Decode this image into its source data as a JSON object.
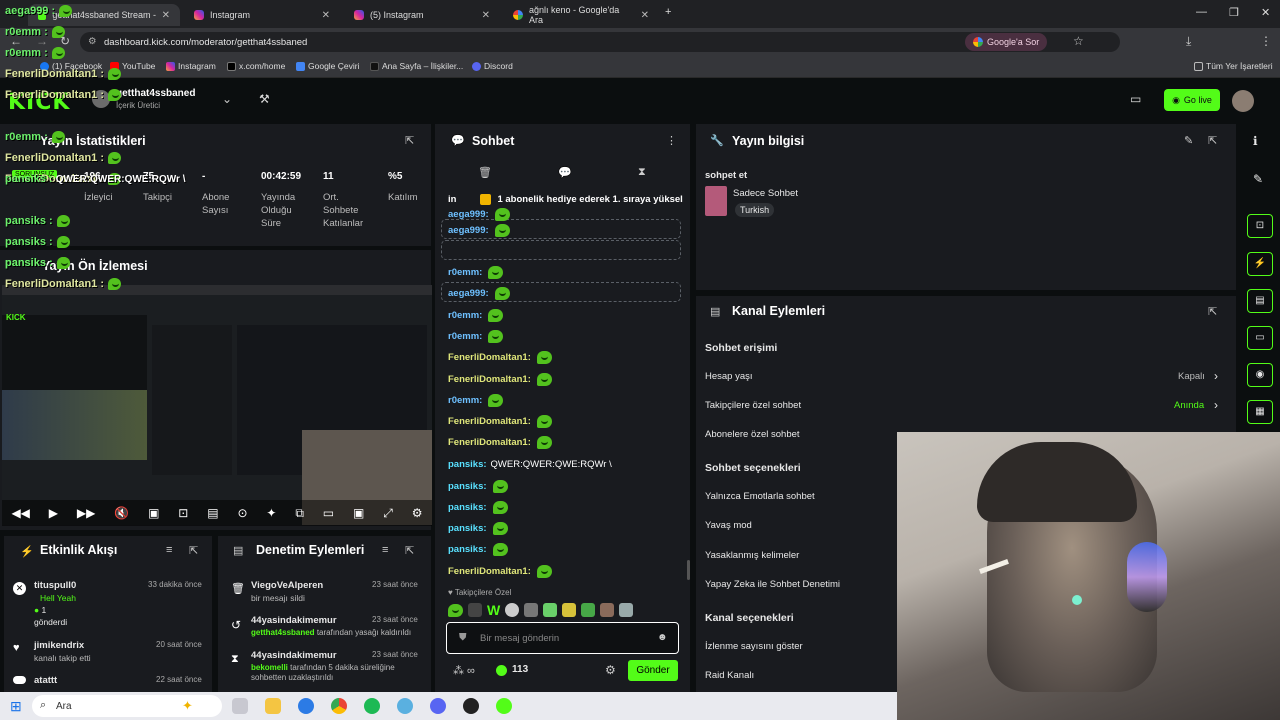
{
  "browser": {
    "tabs": [
      {
        "label": "getthat4ssbaned Stream - Kick",
        "active": true
      },
      {
        "label": "Instagram"
      },
      {
        "label": "(5) Instagram"
      },
      {
        "label": "ağnlı keno - Google'da Ara"
      }
    ],
    "url": "dashboard.kick.com/moderator/getthat4ssbaned",
    "gsor": "Google'a Sor",
    "bookmarks": [
      "(1) Facebook",
      "YouTube",
      "Instagram",
      "x.com/home",
      "Google Çeviri",
      "Ana Sayfa – İlişkiler...",
      "Discord"
    ],
    "all_bookmarks": "Tüm Yer İşaretleri"
  },
  "dash": {
    "logo": "KICK",
    "channel": "getthat4ssbaned",
    "role": "İçerik Üretici",
    "golive": "Go live"
  },
  "stats": {
    "title": "Yayın İstatistikleri",
    "items": [
      {
        "value": "196",
        "label": "İzleyici"
      },
      {
        "value": "75",
        "label": "Takipçi"
      },
      {
        "value": "-",
        "label": "Abone Sayısı"
      },
      {
        "value": "00:42:59",
        "label": "Yayında Olduğu Süre"
      },
      {
        "value": "11",
        "label": "Ort. Sohbete Katılanlar"
      },
      {
        "value": "%5",
        "label": "Katılım"
      }
    ],
    "badge": "SORUNSUZ"
  },
  "preview": {
    "title": "Yayın Ön İzlemesi"
  },
  "overlay_chat": [
    {
      "user": "aega999 :",
      "green": true
    },
    {
      "user": "r0emm :",
      "green": true
    },
    {
      "user": "r0emm :",
      "green": true
    },
    {
      "user": "FenerliDomaltan1 :",
      "green": false
    },
    {
      "user": "FenerliDomaltan1 :",
      "green": false
    },
    {
      "user": "r0emm :",
      "green": true
    },
    {
      "user": "FenerliDomaltan1 :",
      "green": false
    },
    {
      "user": "FenerliDomaltan1 :",
      "green": false
    },
    {
      "user": "pansiks :",
      "green": true,
      "text": "QWER:QWER:QWE:RQWr \\"
    },
    {
      "user": "pansiks :",
      "green": true
    },
    {
      "user": "pansiks :",
      "green": true
    },
    {
      "user": "pansiks :",
      "green": true
    },
    {
      "user": "pansiks :",
      "green": true
    },
    {
      "user": "FenerliDomaltan1 :",
      "green": false
    }
  ],
  "activity": {
    "title": "Etkinlik Akışı",
    "items": [
      {
        "user": "tituspull0",
        "time": "33 dakika önce",
        "sub": "Hell Yeah",
        "extra": "1",
        "desc": "gönderdi"
      },
      {
        "user": "jimikendrix",
        "time": "20 saat önce",
        "desc": "kanalı takip etti"
      },
      {
        "user": "atattt",
        "time": "22 saat önce"
      }
    ]
  },
  "moderation": {
    "title": "Denetim Eylemleri",
    "items": [
      {
        "user": "ViegoVeAlperen",
        "time": "23 saat önce",
        "desc": "bir mesajı sildi"
      },
      {
        "user": "44yasindakimemur",
        "time": "23 saat önce",
        "target": "getthat4ssbaned",
        "desc": "tarafından yasağı kaldırıldı"
      },
      {
        "user": "44yasindakimemur",
        "time": "23 saat önce",
        "target": "bekomelli",
        "desc": "tarafından 5 dakika süreliğine sohbetten uzaklaştırıldı"
      }
    ]
  },
  "chat": {
    "title": "Sohbet",
    "pinned_prefix": "in",
    "pinned": "1 abonelik hediye ederek 1. sıraya yüksel",
    "messages": [
      {
        "user": "aega999:",
        "color": "#6ec0ff",
        "boxed": true
      },
      {
        "user": "aega999:",
        "color": "#6ec0ff",
        "boxed": true
      },
      {
        "user": "r0emm:",
        "color": "#6ec0ff"
      },
      {
        "user": "aega999:",
        "color": "#6ec0ff",
        "boxed": true
      },
      {
        "user": "r0emm:",
        "color": "#6ec0ff"
      },
      {
        "user": "r0emm:",
        "color": "#6ec0ff"
      },
      {
        "user": "FenerliDomaltan1:",
        "color": "#dfe67a"
      },
      {
        "user": "FenerliDomaltan1:",
        "color": "#dfe67a"
      },
      {
        "user": "r0emm:",
        "color": "#6ec0ff"
      },
      {
        "user": "FenerliDomaltan1:",
        "color": "#dfe67a"
      },
      {
        "user": "FenerliDomaltan1:",
        "color": "#dfe67a"
      },
      {
        "user": "pansiks:",
        "color": "#59e1ff",
        "text": "QWER:QWER:QWE:RQWr \\"
      },
      {
        "user": "pansiks:",
        "color": "#59e1ff"
      },
      {
        "user": "pansiks:",
        "color": "#59e1ff"
      },
      {
        "user": "pansiks:",
        "color": "#59e1ff"
      },
      {
        "user": "pansiks:",
        "color": "#59e1ff"
      },
      {
        "user": "FenerliDomaltan1:",
        "color": "#dfe67a"
      }
    ],
    "followers_only": "Takipçilere Özel",
    "placeholder": "Bir mesaj gönderin",
    "points": "113",
    "send": "Gönder"
  },
  "stream_info": {
    "title": "Yayın bilgisi",
    "stream_title": "sohpet et",
    "category": "Sadece Sohbet",
    "tag": "Turkish"
  },
  "channel_actions": {
    "title": "Kanal Eylemleri",
    "chat_access": "Sohbet erişimi",
    "account_age": "Hesap yaşı",
    "account_age_val": "Kapalı",
    "followers_chat": "Takipçilere özel sohbet",
    "followers_chat_val": "Anında",
    "subs_chat": "Abonelere özel sohbet",
    "chat_options": "Sohbet seçenekleri",
    "emotes_only": "Yalnızca Emotlarla sohbet",
    "slow": "Yavaş mod",
    "banned_words": "Yasaklanmış kelimeler",
    "ai_mod": "Yapay Zeka ile Sohbet Denetimi",
    "channel_options": "Kanal seçenekleri",
    "show_views": "İzlenme sayısını göster",
    "raid": "Raid Kanalı"
  },
  "taskbar": {
    "search": "Ara"
  },
  "colors": {
    "accent": "#53fc18",
    "panel": "#191b1f",
    "bg": "#0b0e0f"
  }
}
